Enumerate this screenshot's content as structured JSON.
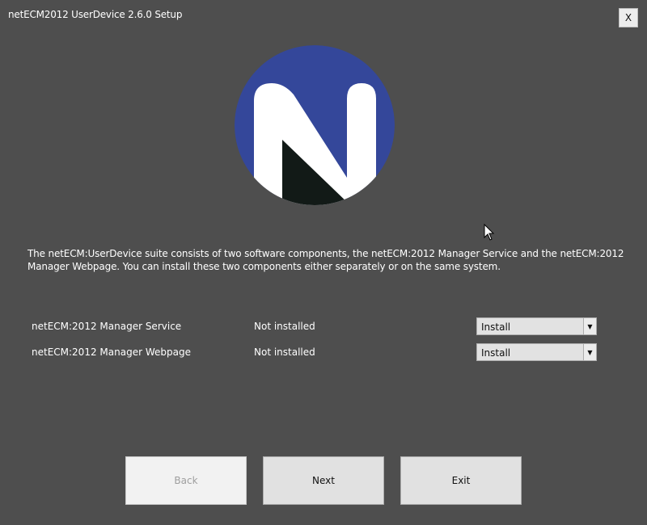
{
  "window": {
    "title": "netECM2012 UserDevice 2.6.0 Setup",
    "close_label": "X"
  },
  "logo": {
    "icon": "netecm-n-logo",
    "circle_color": "#34479a",
    "letter_color": "#ffffff",
    "shadow_color": "#121a17"
  },
  "description": "The netECM:UserDevice suite consists of two software components, the netECM:2012 Manager Service and the netECM:2012 Manager Webpage. You can install these two components either separately or on the same system.",
  "components": [
    {
      "name": "netECM:2012 Manager Service",
      "status": "Not installed",
      "action": "Install"
    },
    {
      "name": "netECM:2012 Manager Webpage",
      "status": "Not installed",
      "action": "Install"
    }
  ],
  "buttons": {
    "back": "Back",
    "next": "Next",
    "exit": "Exit"
  }
}
